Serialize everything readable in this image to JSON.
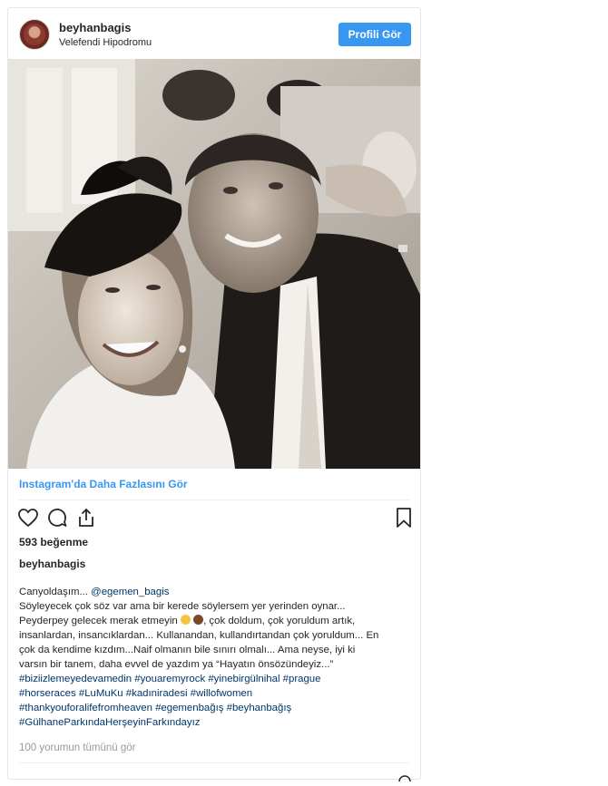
{
  "header": {
    "username": "beyhanbagis",
    "location": "Velefendi Hipodromu",
    "profile_button": "Profili Gör"
  },
  "post": {
    "more_link": "Instagram'da Daha Fazlasını Gör",
    "likes": "593 beğenme",
    "owner": "beyhanbagis",
    "caption": {
      "line1_prefix": "Canyoldaşım... ",
      "mention": "@egemen_bagis",
      "line2": "Söyleyecek çok söz var ama bir kerede söylersem yer yerinden oynar...",
      "line3_a": "Peyderpey gelecek merak etmeyin ",
      "line3_b": ", çok doldum, çok yoruldum artık,",
      "line4": "insanlardan, insancıklardan... Kullanandan, kullandırtandan çok yoruldum... En",
      "line5": "çok da kendime kızdım...Naif olmanın bile sınırı olmalı... Ama neyse, iyi ki",
      "line6": "varsın bir tanem, daha evvel de yazdım ya “Hayatın önsözündeyiz...”",
      "tags_line1": [
        "#biziizlemeyedevamedin",
        "#youaremyrock",
        "#yinebirgülnihal",
        "#prague"
      ],
      "tags_line2": [
        "#horseraces",
        "#LuMuKu",
        "#kadıniradesi",
        "#willofwomen"
      ],
      "tags_line3": [
        "#thankyouforalifefromheaven",
        "#egemenbağış",
        "#beyhanbağış"
      ],
      "tags_line4": [
        "#GülhaneParkındaHerşeyinFarkındayız"
      ]
    },
    "comments_link": "100 yorumun tümünü gör"
  },
  "icons": {
    "heart": "heart-icon",
    "comment": "comment-icon",
    "share": "share-icon",
    "bookmark": "bookmark-icon"
  },
  "colors": {
    "accent": "#3897f0",
    "hashtag": "#003569",
    "muted": "#999999"
  }
}
